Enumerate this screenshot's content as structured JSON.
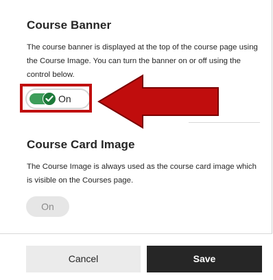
{
  "banner": {
    "title": "Course Banner",
    "description": "The course banner is displayed at the top of the course page using the Course Image. You can turn the banner on or off using the control below.",
    "toggle_label": "On",
    "toggle_state": "on"
  },
  "card_image": {
    "title": "Course Card Image",
    "description": "The Course Image is always used as the course card image which is visible on the Courses page.",
    "toggle_label": "On",
    "toggle_state": "disabled"
  },
  "footer": {
    "cancel_label": "Cancel",
    "save_label": "Save"
  },
  "annotation": {
    "arrow_icon": "left-arrow-icon",
    "color": "#c00d0d"
  },
  "colors": {
    "toggle_on": "#3d9d5a",
    "save_button": "#262626",
    "cancel_button": "#ebebeb"
  }
}
